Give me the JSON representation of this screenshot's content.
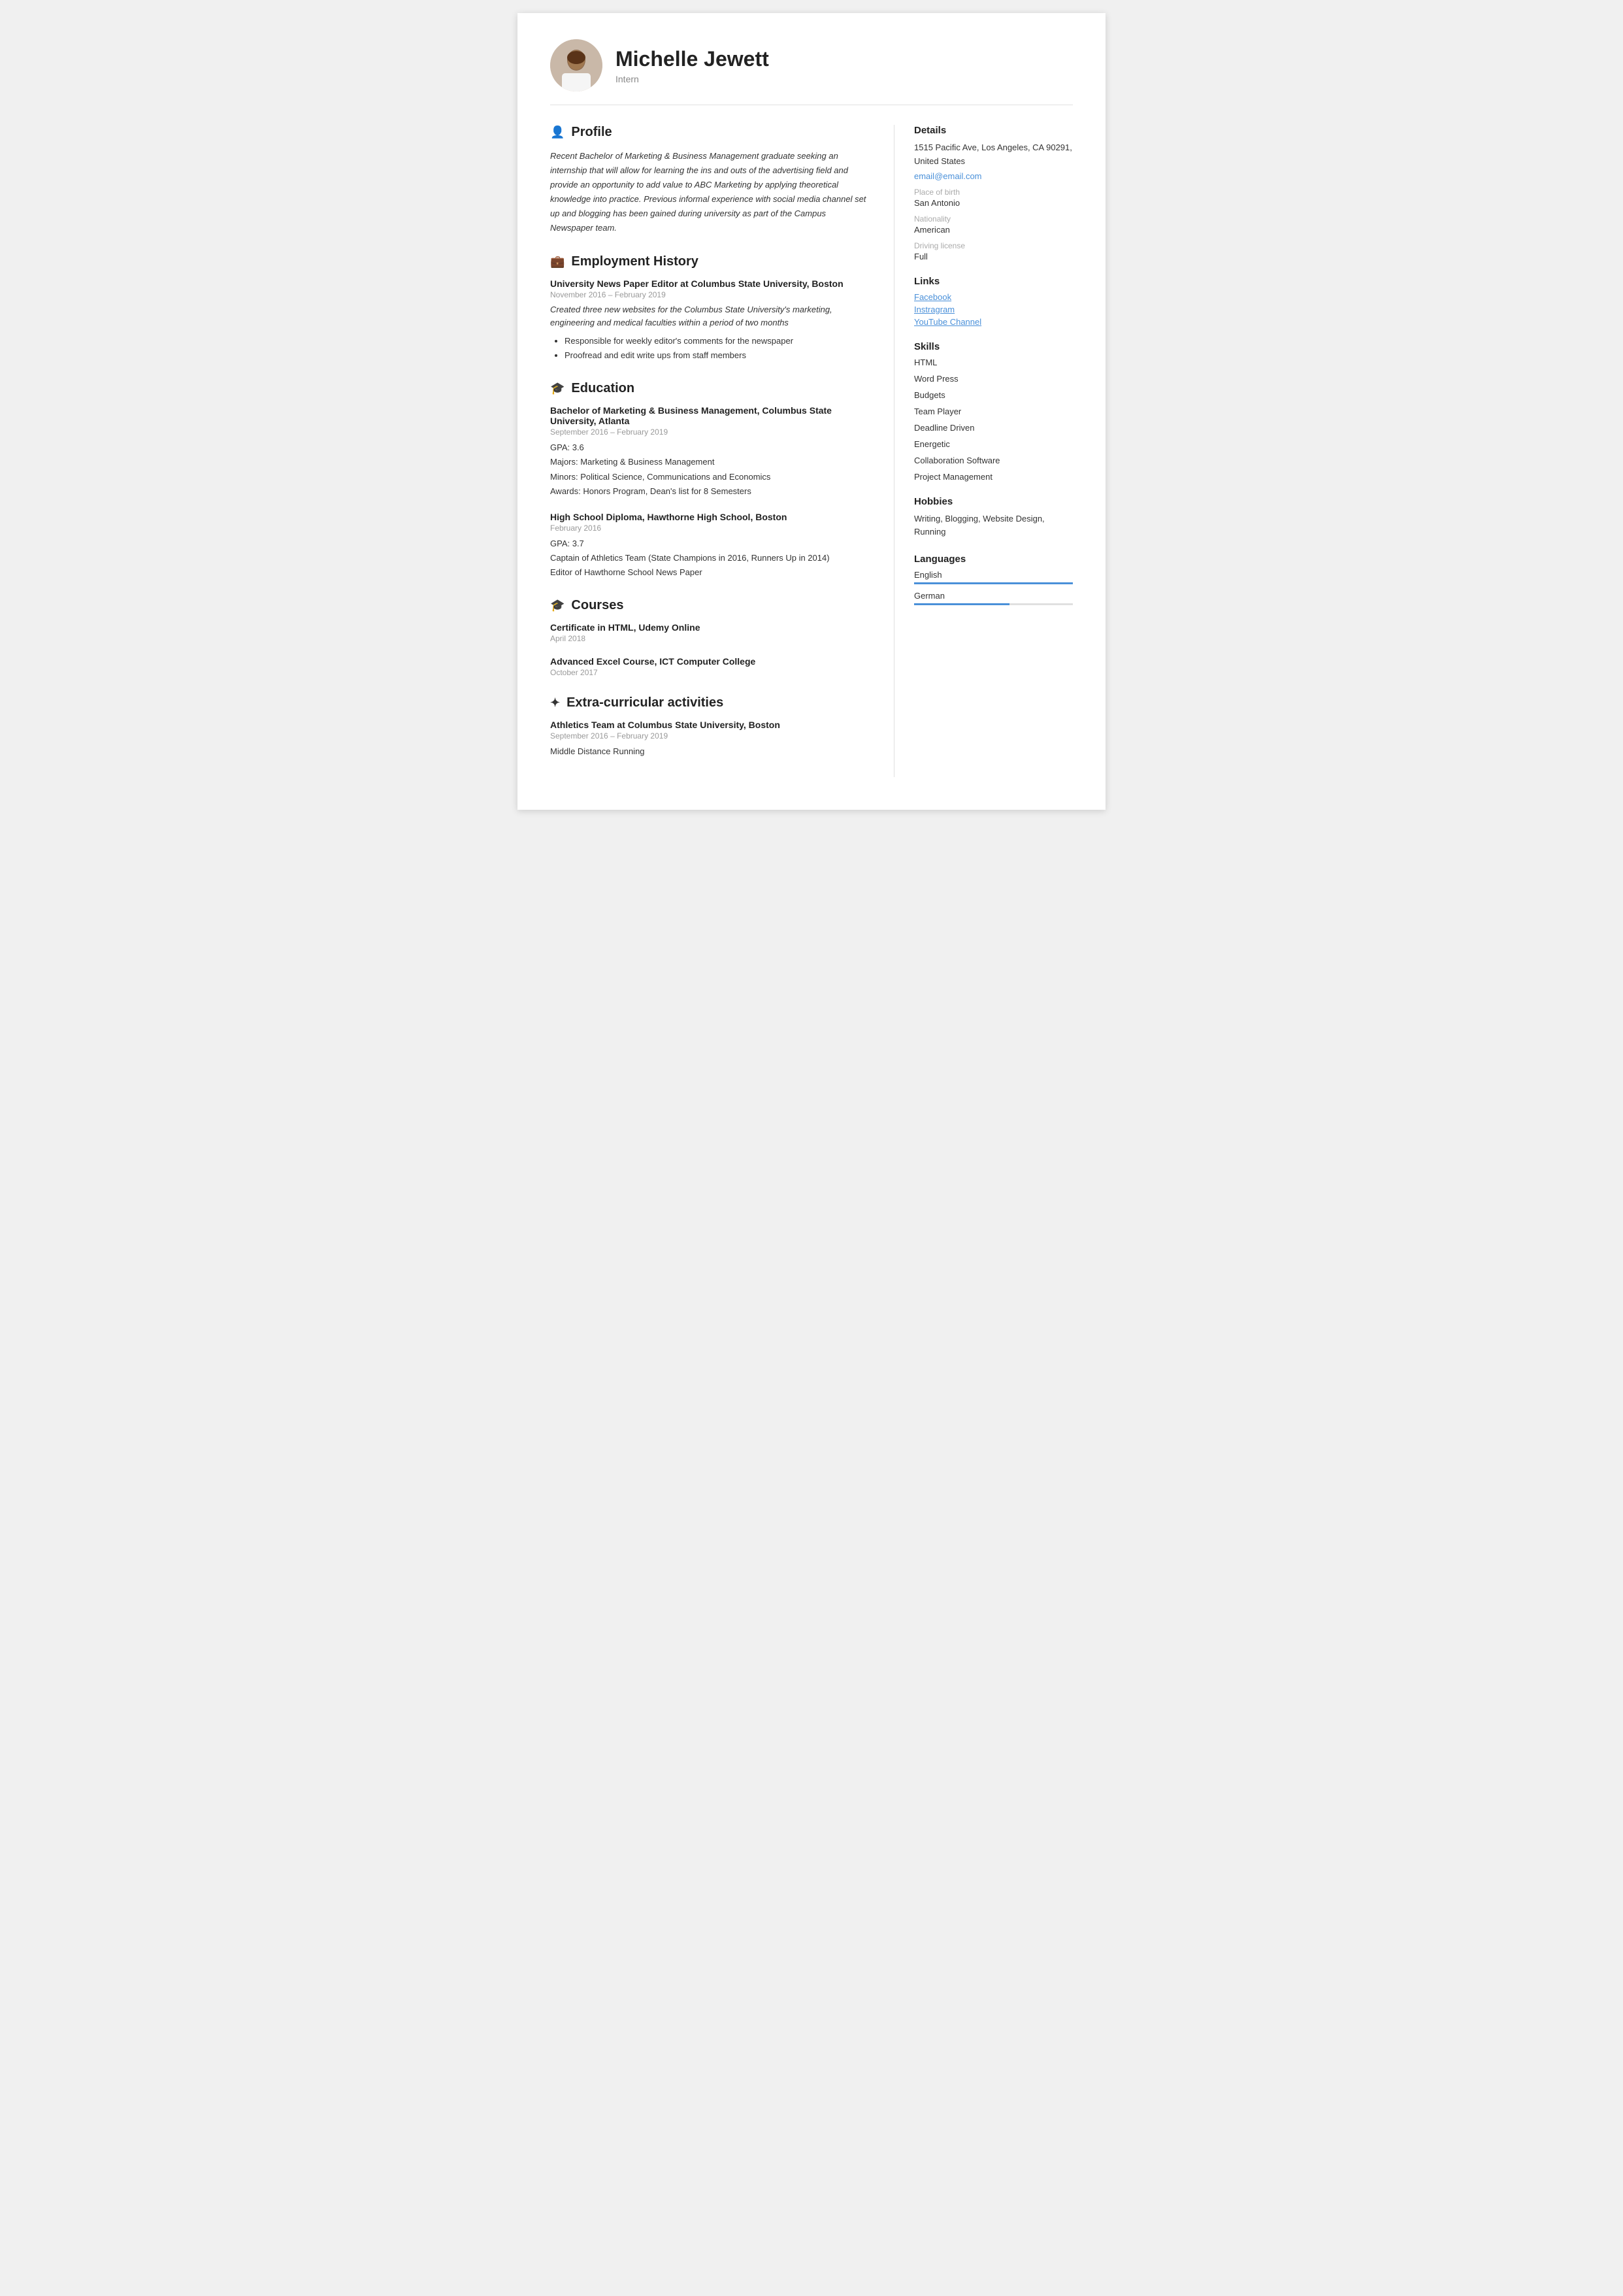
{
  "header": {
    "name": "Michelle Jewett",
    "subtitle": "Intern",
    "avatar_alt": "Profile photo"
  },
  "profile": {
    "section_title": "Profile",
    "text": "Recent Bachelor of Marketing & Business Management graduate seeking an internship that will allow for learning the ins and outs of the advertising field and provide an opportunity to add value to ABC Marketing by applying theoretical knowledge into practice. Previous informal experience with social media channel set up and blogging has been gained during university as part of the Campus Newspaper team."
  },
  "employment": {
    "section_title": "Employment History",
    "entries": [
      {
        "title": "University News Paper Editor at Columbus State University, Boston",
        "date": "November 2016 – February 2019",
        "desc": "Created three new websites for the Columbus State University's marketing, engineering and medical faculties within a period of two months",
        "bullets": [
          "Responsible for weekly editor's comments for the newspaper",
          "Proofread and edit write ups from staff members"
        ]
      }
    ]
  },
  "education": {
    "section_title": "Education",
    "entries": [
      {
        "title": "Bachelor of Marketing & Business Management, Columbus State University, Atlanta",
        "date": "September 2016 – February 2019",
        "details": [
          "GPA: 3.6",
          "Majors: Marketing & Business Management",
          "Minors: Political Science, Communications and Economics",
          "Awards: Honors Program, Dean's list for 8 Semesters"
        ]
      },
      {
        "title": "High School Diploma, Hawthorne High School, Boston",
        "date": "February 2016",
        "details": [
          "GPA: 3.7",
          "Captain of Athletics Team (State Champions in 2016, Runners Up in 2014)",
          "Editor of Hawthorne School News Paper"
        ]
      }
    ]
  },
  "courses": {
    "section_title": "Courses",
    "entries": [
      {
        "title": "Certificate in HTML, Udemy Online",
        "date": "April 2018"
      },
      {
        "title": "Advanced Excel Course, ICT Computer College",
        "date": "October 2017"
      }
    ]
  },
  "extracurricular": {
    "section_title": "Extra-curricular activities",
    "entries": [
      {
        "title": "Athletics Team at Columbus State University, Boston",
        "date": "September 2016 – February 2019",
        "details": [
          "Middle Distance Running"
        ]
      }
    ]
  },
  "details": {
    "section_title": "Details",
    "address": "1515 Pacific Ave, Los Angeles, CA 90291, United States",
    "email": "email@email.com",
    "place_of_birth_label": "Place of birth",
    "place_of_birth": "San Antonio",
    "nationality_label": "Nationality",
    "nationality": "American",
    "driving_license_label": "Driving license",
    "driving_license": "Full"
  },
  "links": {
    "section_title": "Links",
    "items": [
      {
        "label": "Facebook"
      },
      {
        "label": "Instragram"
      },
      {
        "label": "YouTube Channel"
      }
    ]
  },
  "skills": {
    "section_title": "Skills",
    "items": [
      "HTML",
      "Word Press",
      "Budgets",
      "Team Player",
      "Deadline Driven",
      "Energetic",
      "Collaboration Software",
      "Project Management"
    ]
  },
  "hobbies": {
    "section_title": "Hobbies",
    "text": "Writing, Blogging, Website Design, Running"
  },
  "languages": {
    "section_title": "Languages",
    "items": [
      {
        "name": "English",
        "level": 100
      },
      {
        "name": "German",
        "level": 60
      }
    ]
  }
}
